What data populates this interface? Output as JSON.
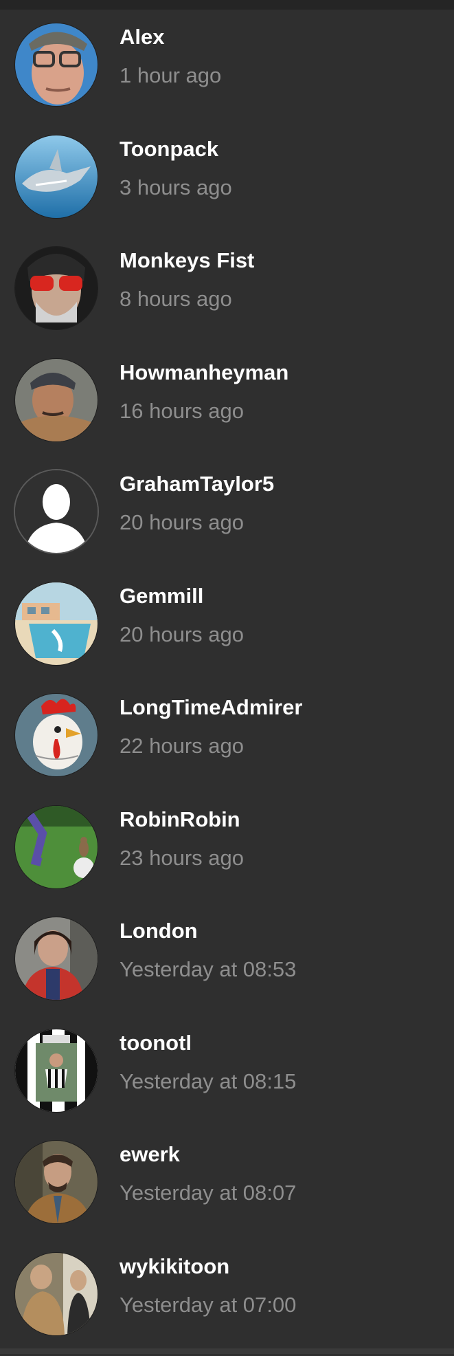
{
  "users": [
    {
      "name": "Alex",
      "time": "1 hour ago"
    },
    {
      "name": "Toonpack",
      "time": "3 hours ago"
    },
    {
      "name": "Monkeys Fist",
      "time": "8 hours ago"
    },
    {
      "name": "Howmanheyman",
      "time": "16 hours ago"
    },
    {
      "name": "GrahamTaylor5",
      "time": "20 hours ago"
    },
    {
      "name": "Gemmill",
      "time": "20 hours ago"
    },
    {
      "name": "LongTimeAdmirer",
      "time": "22 hours ago"
    },
    {
      "name": "RobinRobin",
      "time": "23 hours ago"
    },
    {
      "name": "London",
      "time": "Yesterday at 08:53"
    },
    {
      "name": "toonotl",
      "time": "Yesterday at 08:15"
    },
    {
      "name": "ewerk",
      "time": "Yesterday at 08:07"
    },
    {
      "name": "wykikitoon",
      "time": "Yesterday at 07:00"
    }
  ]
}
